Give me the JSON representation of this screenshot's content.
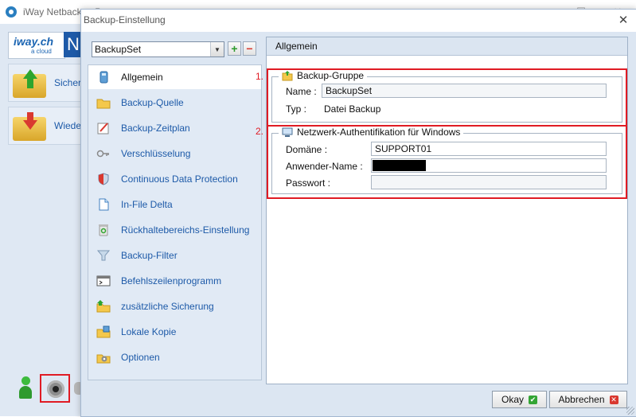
{
  "app": {
    "title": "iWay Netbackup Pro",
    "logo_text": "iway.ch",
    "logo_sub": "a cloud",
    "logo_right": "N",
    "nav": [
      {
        "label": "Sicher"
      },
      {
        "label": "Wiede"
      }
    ],
    "window_controls": {
      "min": "—",
      "max": "☐",
      "close": "✕"
    }
  },
  "dialog": {
    "title": "Backup-Einstellung",
    "close_glyph": "✕",
    "backupset_select": {
      "value": "BackupSet",
      "arrow": "▼",
      "add": "+",
      "remove": "−"
    },
    "nav_items": [
      {
        "label": "Allgemein",
        "icon": "general-icon",
        "selected": true
      },
      {
        "label": "Backup-Quelle",
        "icon": "folder-icon"
      },
      {
        "label": "Backup-Zeitplan",
        "icon": "schedule-icon"
      },
      {
        "label": "Verschlüsselung",
        "icon": "key-icon"
      },
      {
        "label": "Continuous Data Protection",
        "icon": "shield-icon"
      },
      {
        "label": "In-File Delta",
        "icon": "document-icon"
      },
      {
        "label": "Rückhaltebereichs-Einstellung",
        "icon": "recycle-bin-icon"
      },
      {
        "label": "Backup-Filter",
        "icon": "funnel-icon"
      },
      {
        "label": "Befehlszeilenprogramm",
        "icon": "command-line-icon"
      },
      {
        "label": "zusätzliche Sicherung",
        "icon": "extra-backup-icon"
      },
      {
        "label": "Lokale Kopie",
        "icon": "local-copy-icon"
      },
      {
        "label": "Optionen",
        "icon": "options-icon"
      }
    ],
    "panel_header": "Allgemein",
    "group1": {
      "marker": "1.",
      "title": "Backup-Gruppe",
      "name_label": "Name :",
      "name_value": "BackupSet",
      "type_label": "Typ :",
      "type_value": "Datei Backup"
    },
    "group2": {
      "marker": "2.",
      "title": "Netzwerk-Authentifikation für Windows",
      "domain_label": "Domäne :",
      "domain_value": "SUPPORT01",
      "user_label": "Anwender-Name :",
      "user_value": "",
      "password_label": "Passwort :",
      "password_value": ""
    },
    "buttons": {
      "ok": "Okay",
      "ok_glyph": "✔",
      "cancel": "Abbrechen",
      "cancel_glyph": "✕"
    }
  },
  "colors": {
    "accent_blue": "#1d5aa8",
    "highlight_red": "#e01b24",
    "panel_bg": "#dce6f2"
  }
}
